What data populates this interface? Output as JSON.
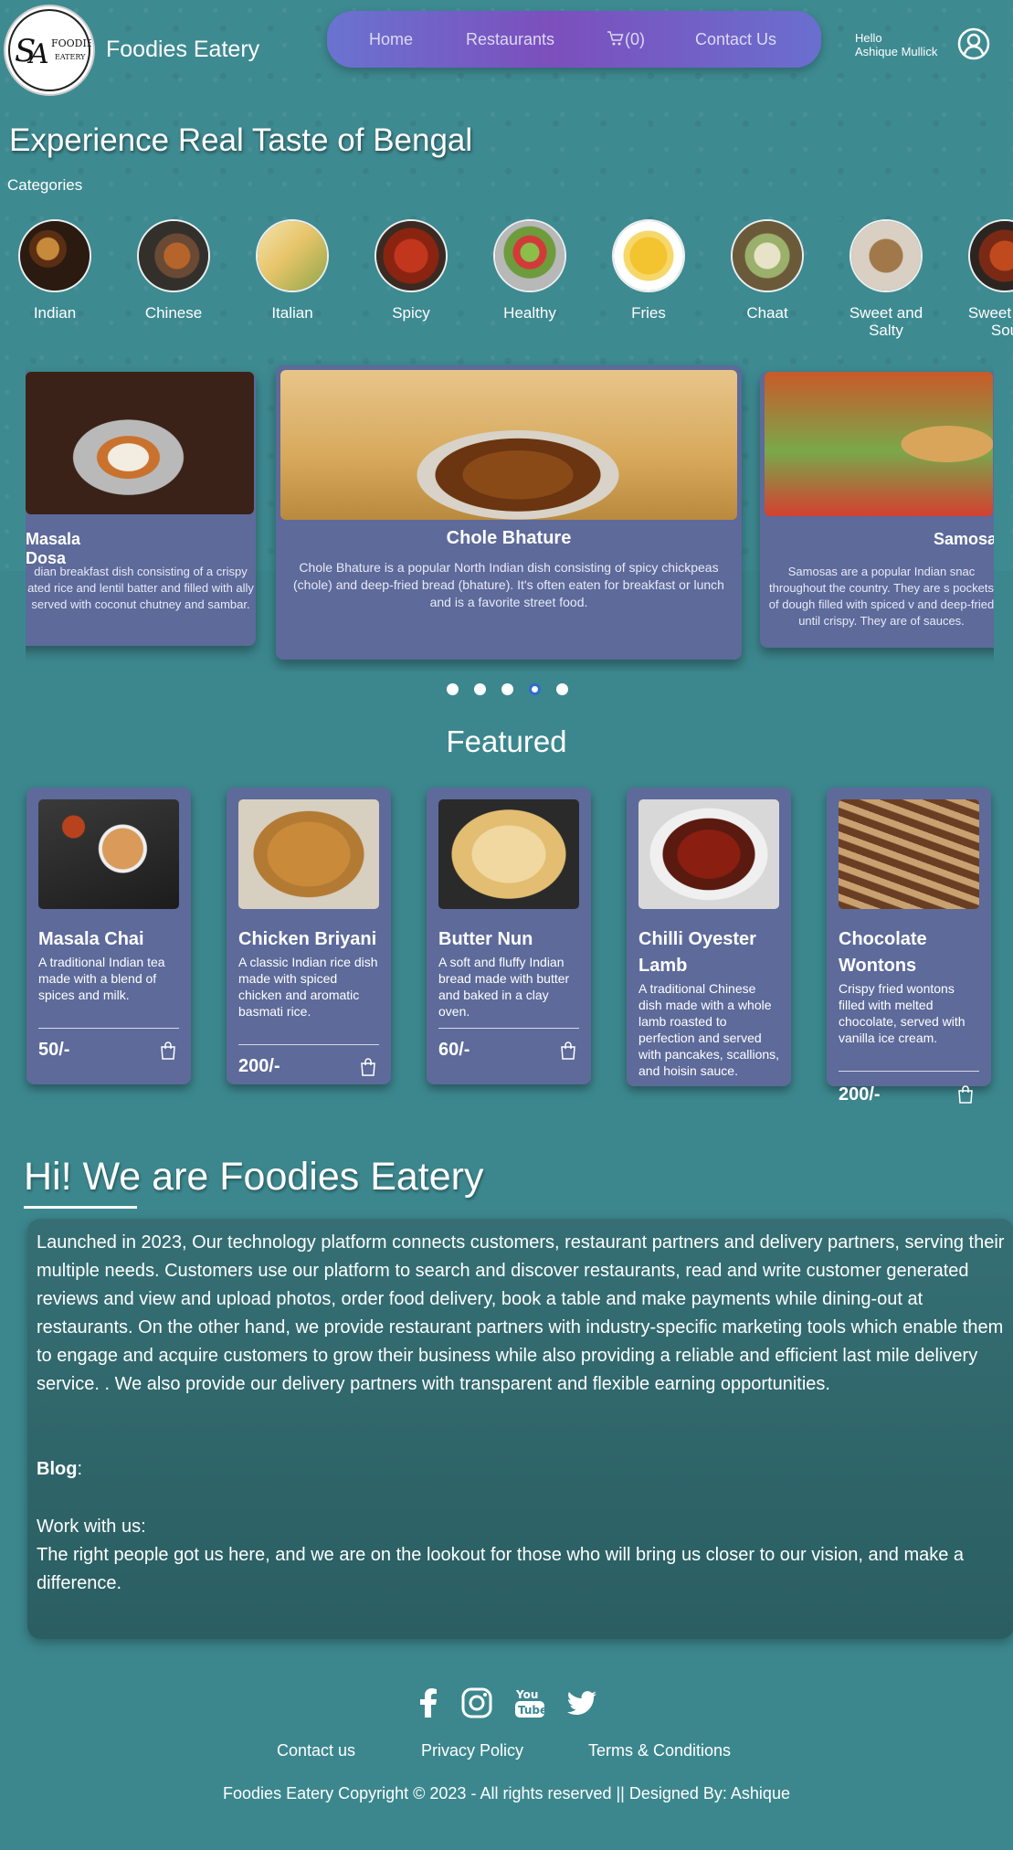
{
  "header": {
    "logo_text": "SA FOODIES EATERY",
    "brand": "Foodies Eatery",
    "nav": {
      "home": "Home",
      "restaurants": "Restaurants",
      "cart": "(0)",
      "contact": "Contact Us"
    },
    "greeting": "Hello",
    "user_name": "Ashique Mullick"
  },
  "hero": {
    "title": "Experience Real Taste of Bengal",
    "categories_label": "Categories",
    "categories": [
      {
        "name": "Indian"
      },
      {
        "name": "Chinese"
      },
      {
        "name": "Italian"
      },
      {
        "name": "Spicy"
      },
      {
        "name": "Healthy"
      },
      {
        "name": "Fries"
      },
      {
        "name": "Chaat"
      },
      {
        "name": "Sweet and Salty"
      },
      {
        "name": "Sweet and Sou"
      }
    ]
  },
  "carousel": {
    "slides": [
      {
        "title": "Masala Dosa",
        "text": "dian breakfast dish consisting of a crispy ated rice and lentil batter and filled with ally served with coconut chutney and sambar."
      },
      {
        "title": "Chole Bhature",
        "text": "Chole Bhature is a popular North Indian dish consisting of spicy chickpeas (chole) and deep-fried bread (bhature). It's often eaten for breakfast or lunch and is a favorite street food."
      },
      {
        "title": "Samosas",
        "text": "Samosas are a popular Indian snac throughout the country. They are s pockets of dough filled with spiced v and deep-fried until crispy. They are of sauces."
      }
    ],
    "dots": 5,
    "active_dot": 4
  },
  "featured": {
    "title": "Featured",
    "items": [
      {
        "name": "Masala Chai",
        "desc": "A traditional Indian tea made with a blend of spices and milk.",
        "price": "50/-"
      },
      {
        "name": "Chicken Briyani",
        "desc": "A classic Indian rice dish made with spiced chicken and aromatic basmati rice.",
        "price": "200/-"
      },
      {
        "name": "Butter Nun",
        "desc": "A soft and fluffy Indian bread made with butter and baked in a clay oven.",
        "price": "60/-"
      },
      {
        "name": "Chilli Oyester Lamb",
        "desc": "A traditional Chinese dish made with a whole lamb roasted to perfection and served with pancakes, scallions, and hoisin sauce.",
        "price": ""
      },
      {
        "name": "Chocolate Wontons",
        "desc": "Crispy fried wontons filled with melted chocolate, served with vanilla ice cream.",
        "price": "200/-"
      }
    ]
  },
  "about": {
    "title": "Hi! We are Foodies Eatery",
    "intro": "Launched in 2023, Our technology platform connects customers, restaurant partners and delivery partners, serving their multiple needs. Customers use our platform to search and discover restaurants, read and write customer generated reviews and view and upload photos, order food delivery, book a table and make payments while dining-out at restaurants. On the other hand, we provide restaurant partners with industry-specific marketing tools which enable them to engage and acquire customers to grow their business while also providing a reliable and efficient last mile delivery service. . We also provide our delivery partners with transparent and flexible earning opportunities.",
    "blog_label": "Blog",
    "blog_colon": ":",
    "work_label": "Work with us:",
    "work_text": "The right people got us here, and we are on the lookout for those who will bring us closer to our vision, and make a difference."
  },
  "footer": {
    "social": [
      "facebook-icon",
      "instagram-icon",
      "youtube-icon",
      "twitter-icon"
    ],
    "links": {
      "contact": "Contact us",
      "privacy": "Privacy Policy",
      "terms": "Terms & Conditions"
    },
    "copyright": "Foodies Eatery Copyright © 2023 - All rights reserved || Designed By: Ashique"
  },
  "colors": {
    "background": "#3c878e",
    "card": "#5d6a9a",
    "nav_gradient_start": "#6a73d0",
    "nav_gradient_mid": "#7c4fbd",
    "active_dot": "#2f6bd0"
  }
}
